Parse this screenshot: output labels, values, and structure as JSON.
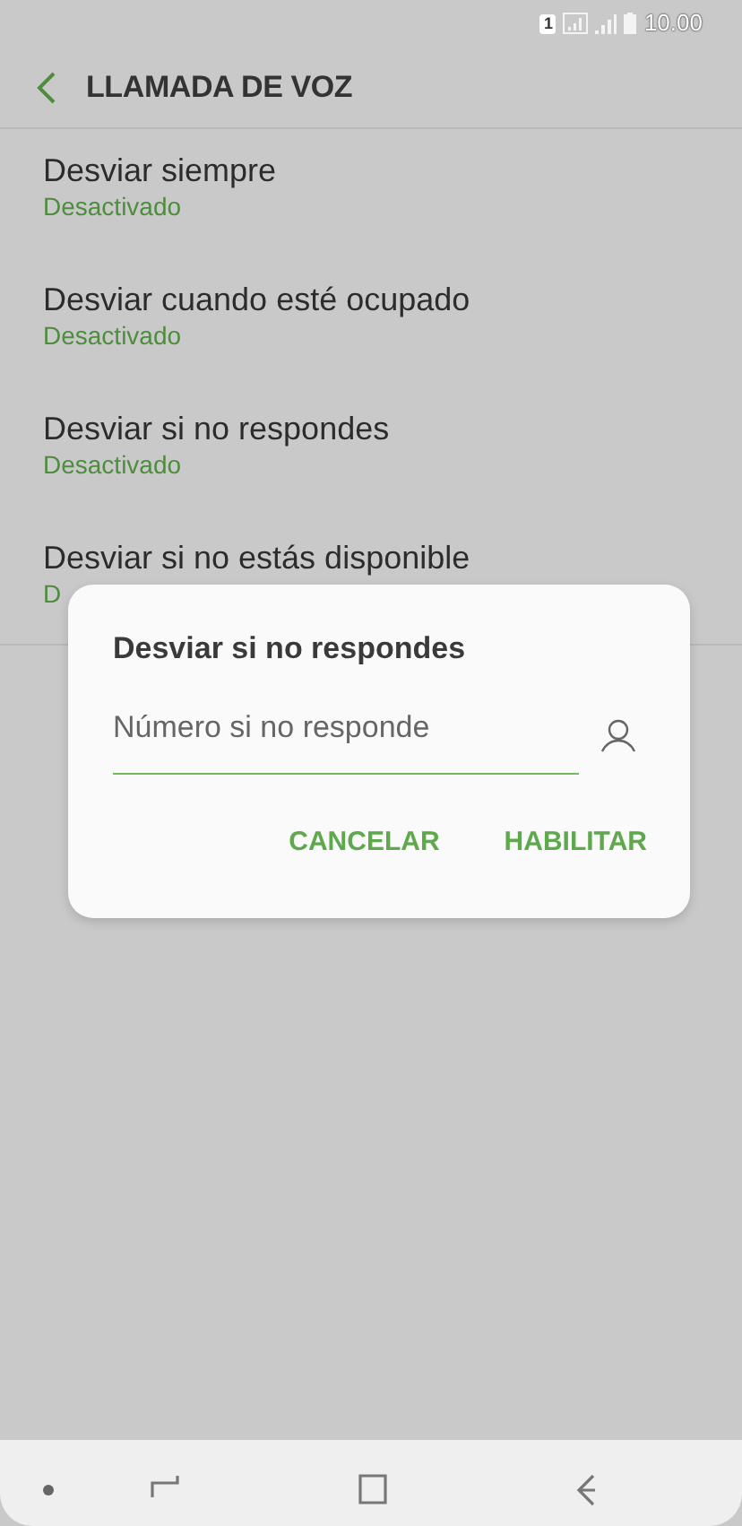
{
  "status_bar": {
    "sim": "1",
    "time": "10.00"
  },
  "header": {
    "title": "LLAMADA DE VOZ"
  },
  "items": [
    {
      "title": "Desviar siempre",
      "subtitle": "Desactivado"
    },
    {
      "title": "Desviar cuando esté ocupado",
      "subtitle": "Desactivado"
    },
    {
      "title": "Desviar si no respondes",
      "subtitle": "Desactivado"
    },
    {
      "title": "Desviar si no estás disponible",
      "subtitle": "D"
    }
  ],
  "dialog": {
    "title": "Desviar si no respondes",
    "placeholder": "Número si no responde",
    "buttons": [
      "CANCELAR",
      "HABILITAR"
    ]
  }
}
